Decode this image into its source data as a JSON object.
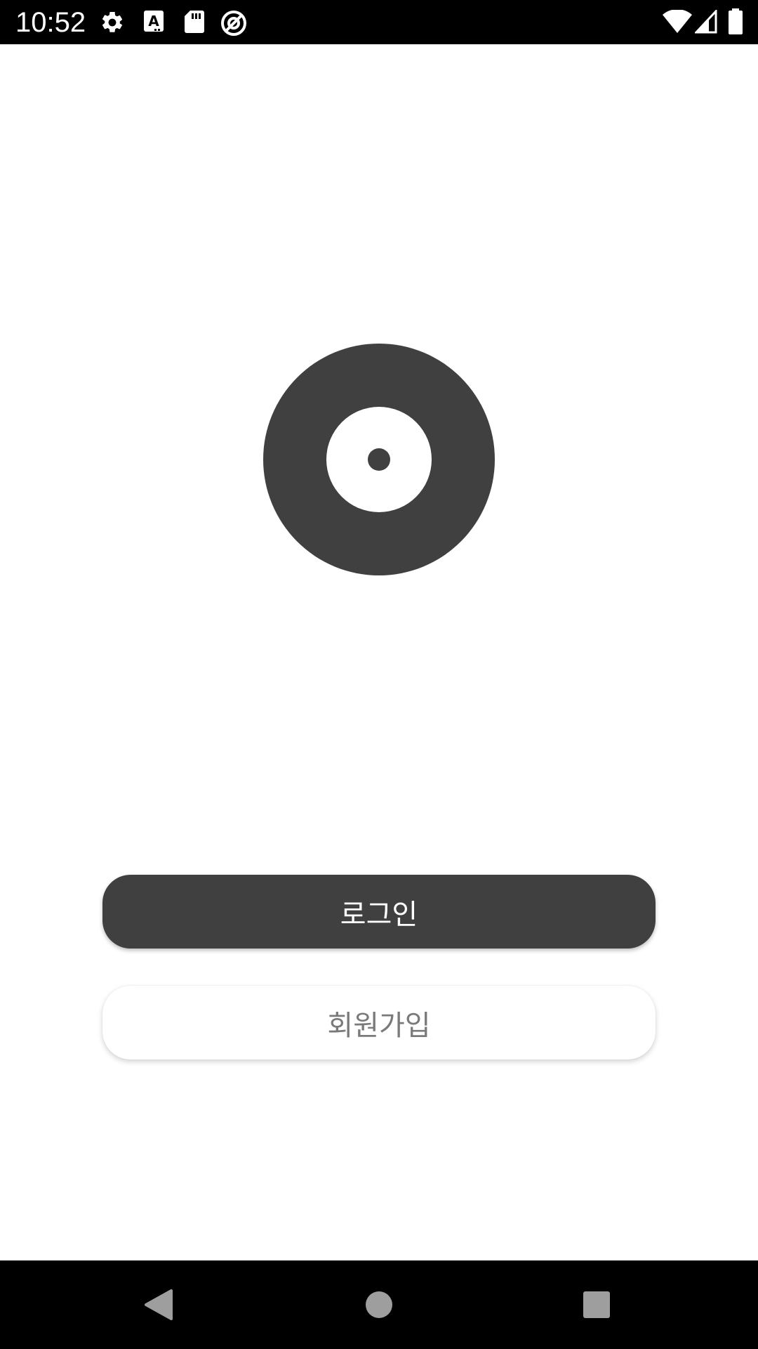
{
  "status_bar": {
    "time": "10:52",
    "left_icons": [
      "gear-icon",
      "text-a-icon",
      "sd-card-icon",
      "vpn-icon"
    ],
    "right_icons": [
      "wifi-icon",
      "signal-icon",
      "battery-icon"
    ]
  },
  "logo": {
    "icon": "vinyl-disc-logo",
    "color": "#404040"
  },
  "buttons": {
    "login_label": "로그인",
    "signup_label": "회원가입"
  },
  "nav_bar": {
    "back": "back-triangle-icon",
    "home": "home-circle-icon",
    "recents": "recents-square-icon"
  },
  "colors": {
    "primary": "#404040",
    "secondary_text": "#7a7a7a",
    "system_bar": "#000000"
  }
}
